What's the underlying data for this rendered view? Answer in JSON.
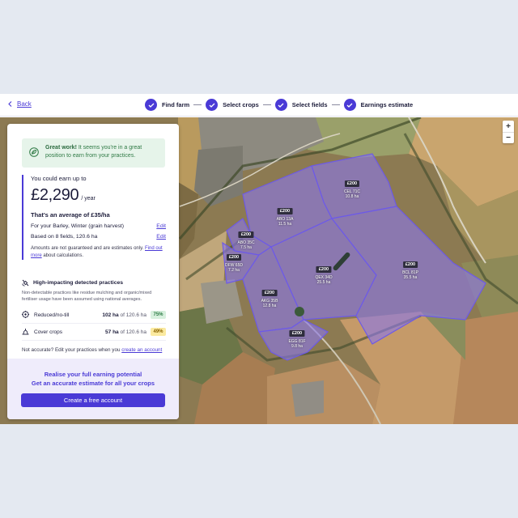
{
  "header": {
    "back_label": "Back",
    "steps": [
      {
        "label": "Find farm"
      },
      {
        "label": "Select crops"
      },
      {
        "label": "Select fields"
      },
      {
        "label": "Earnings estimate"
      }
    ]
  },
  "map": {
    "zoom_in": "+",
    "zoom_out": "−",
    "fields": [
      {
        "value": "£200",
        "code": "CEL 71C",
        "area": "10.8 ha"
      },
      {
        "value": "£200",
        "code": "ABO 13A",
        "area": "11.5 ha"
      },
      {
        "value": "£200",
        "code": "ABO 35C",
        "area": "7.5 ha"
      },
      {
        "value": "£200",
        "code": "DFW 65D",
        "area": "7.2 ha"
      },
      {
        "value": "£200",
        "code": "QEX 34D",
        "area": "25.5 ha"
      },
      {
        "value": "£200",
        "code": "BCL 81P",
        "area": "35.5 ha"
      },
      {
        "value": "£200",
        "code": "AKG 35B",
        "area": "12.8 ha"
      },
      {
        "value": "£200",
        "code": "EGG 81F",
        "area": "9.8 ha"
      }
    ]
  },
  "panel": {
    "success_strong": "Great work!",
    "success_text": " It seems you're in a great position to earn from your practices.",
    "earn_intro": "You could earn up to",
    "earn_amount": "£2,290",
    "earn_unit": "/ year",
    "earn_average": "That's an average of £35/ha",
    "crop_line": "For your Barley, Winter (grain harvest)",
    "fields_line": "Based on 8 fields, 120.6 ha",
    "edit_label": "Edit",
    "note_text": "Amounts are not guaranteed and are estimates only. ",
    "note_link": "Find out more",
    "note_tail": " about calculations.",
    "practices_title": "High-impacting detected practices",
    "practices_desc": "Non-detectable practices like residue mulching and organic/mixed fertiliser usage have been assumed using national averages.",
    "practices": [
      {
        "name": "Reduced/no-till",
        "area": "102 ha",
        "of": " of 120.6 ha",
        "percent": "75%"
      },
      {
        "name": "Cover crops",
        "area": "57 ha",
        "of": " of 120.6 ha",
        "percent": "49%"
      }
    ],
    "not_accurate_text": "Not accurate? Edit your practices when you ",
    "not_accurate_link": "create an account",
    "cta_title": "Realise your full earning potential",
    "cta_subtitle": "Get an accurate estimate for all your crops",
    "cta_button": "Create a free account"
  },
  "colors": {
    "accent": "#4a3ad6",
    "success_bg": "#e6f4ea",
    "field_fill": "#8a78e8"
  }
}
